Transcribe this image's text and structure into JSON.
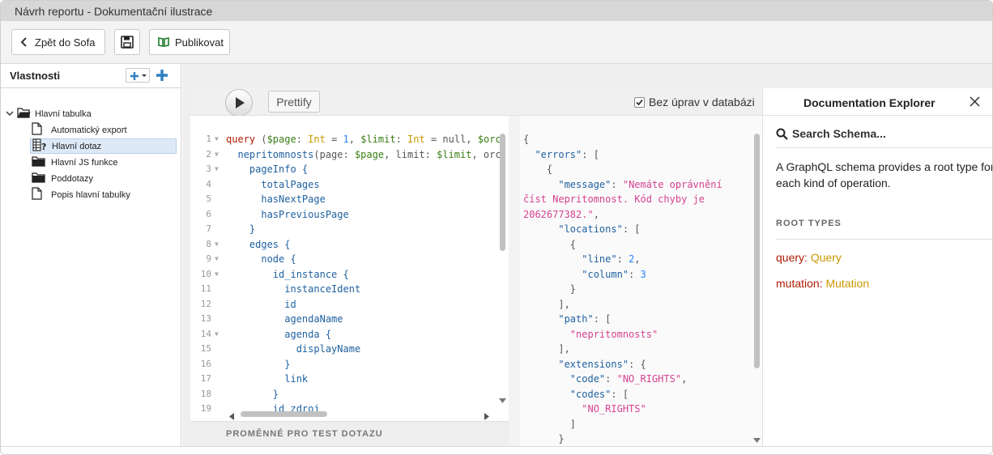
{
  "window": {
    "title": "Návrh reportu - Dokumentační ilustrace"
  },
  "toolbar": {
    "back_label": "Zpět do Sofa",
    "publish_label": "Publikovat"
  },
  "properties_panel": {
    "title": "Vlastnosti",
    "tree": [
      {
        "label": "Hlavní tabulka",
        "icon": "folder-open-icon",
        "level": 0,
        "expanded": true
      },
      {
        "label": "Automatický export",
        "icon": "document-icon",
        "level": 1
      },
      {
        "label": "Hlavní dotaz",
        "icon": "query-icon",
        "level": 1,
        "selected": true
      },
      {
        "label": "Hlavní JS funkce",
        "icon": "folder-icon",
        "level": 1
      },
      {
        "label": "Poddotazy",
        "icon": "folder-icon",
        "level": 1
      },
      {
        "label": "Popis hlavní tabulky",
        "icon": "document-icon",
        "level": 1
      }
    ]
  },
  "graphiql": {
    "prettify_label": "Prettify",
    "readonly_checkbox": {
      "label": "Bez úprav v databázi",
      "checked": true
    },
    "variables_label": "PROMĚNNÉ PRO TEST DOTAZU",
    "query_lines": [
      {
        "n": "1",
        "fold": true
      },
      {
        "n": "2",
        "fold": true
      },
      {
        "n": "3",
        "fold": true
      },
      {
        "n": "4",
        "fold": false
      },
      {
        "n": "5",
        "fold": false
      },
      {
        "n": "6",
        "fold": false
      },
      {
        "n": "7",
        "fold": false
      },
      {
        "n": "8",
        "fold": true
      },
      {
        "n": "9",
        "fold": true
      },
      {
        "n": "10",
        "fold": true
      },
      {
        "n": "11",
        "fold": false
      },
      {
        "n": "12",
        "fold": false
      },
      {
        "n": "13",
        "fold": false
      },
      {
        "n": "14",
        "fold": true
      },
      {
        "n": "15",
        "fold": false
      },
      {
        "n": "16",
        "fold": false
      },
      {
        "n": "17",
        "fold": false
      },
      {
        "n": "18",
        "fold": false
      },
      {
        "n": "19",
        "fold": false
      }
    ],
    "query_text": {
      "l1": [
        "query",
        " (",
        "$page",
        ": ",
        "Int",
        " = ",
        "1",
        ", ",
        "$limit",
        ": ",
        "Int",
        " = null, ",
        "$orc"
      ],
      "l2": [
        "  ",
        "nepritomnosts",
        "(page: ",
        "$page",
        ", limit: ",
        "$limit",
        ", orc"
      ],
      "l3": "    pageInfo {",
      "l4": "      totalPages",
      "l5": "      hasNextPage",
      "l6": "      hasPreviousPage",
      "l7": "    }",
      "l8": "    edges {",
      "l9": "      node {",
      "l10": "        id_instance {",
      "l11": "          instanceIdent",
      "l12": "          id",
      "l13": "          agendaName",
      "l14": "          agenda {",
      "l15": "            displayName",
      "l16": "          }",
      "l17": "          link",
      "l18": "        }",
      "l19": "        id_zdroj"
    },
    "result_text": {
      "r1": "{",
      "r2k": "\"errors\"",
      "r2p": ": [",
      "r3": "{",
      "r4k": "\"message\"",
      "r4p": ": ",
      "r4s": "\"Nemáte oprávnění",
      "r5s": "číst Nepritomnost. Kód chyby je",
      "r6s": "2062677382.\"",
      "r6p": ",",
      "r7k": "\"locations\"",
      "r7p": ": [",
      "r8": "{",
      "r9k": "\"line\"",
      "r9p": ": ",
      "r9n": "2",
      "r9e": ",",
      "r10k": "\"column\"",
      "r10p": ": ",
      "r10n": "3",
      "r11": "}",
      "r12": "],",
      "r13k": "\"path\"",
      "r13p": ": [",
      "r14s": "\"nepritomnosts\"",
      "r15": "],",
      "r16k": "\"extensions\"",
      "r16p": ": {",
      "r17k": "\"code\"",
      "r17p": ": ",
      "r17s": "\"NO_RIGHTS\"",
      "r17e": ",",
      "r18k": "\"codes\"",
      "r18p": ": [",
      "r19s": "\"NO_RIGHTS\"",
      "r20": "]",
      "r21": "}"
    }
  },
  "doc_explorer": {
    "title": "Documentation Explorer",
    "search_placeholder": "Search Schema...",
    "description": "A GraphQL schema provides a root type for each kind of operation.",
    "root_types_label": "ROOT TYPES",
    "root_types": [
      {
        "key": "query",
        "type": "Query"
      },
      {
        "key": "mutation",
        "type": "Mutation"
      }
    ]
  },
  "colors": {
    "accent_blue": "#2f7fc1",
    "keyword": "#b11a04",
    "type": "#ca9800",
    "string": "#d64292",
    "number": "#2882f9"
  }
}
